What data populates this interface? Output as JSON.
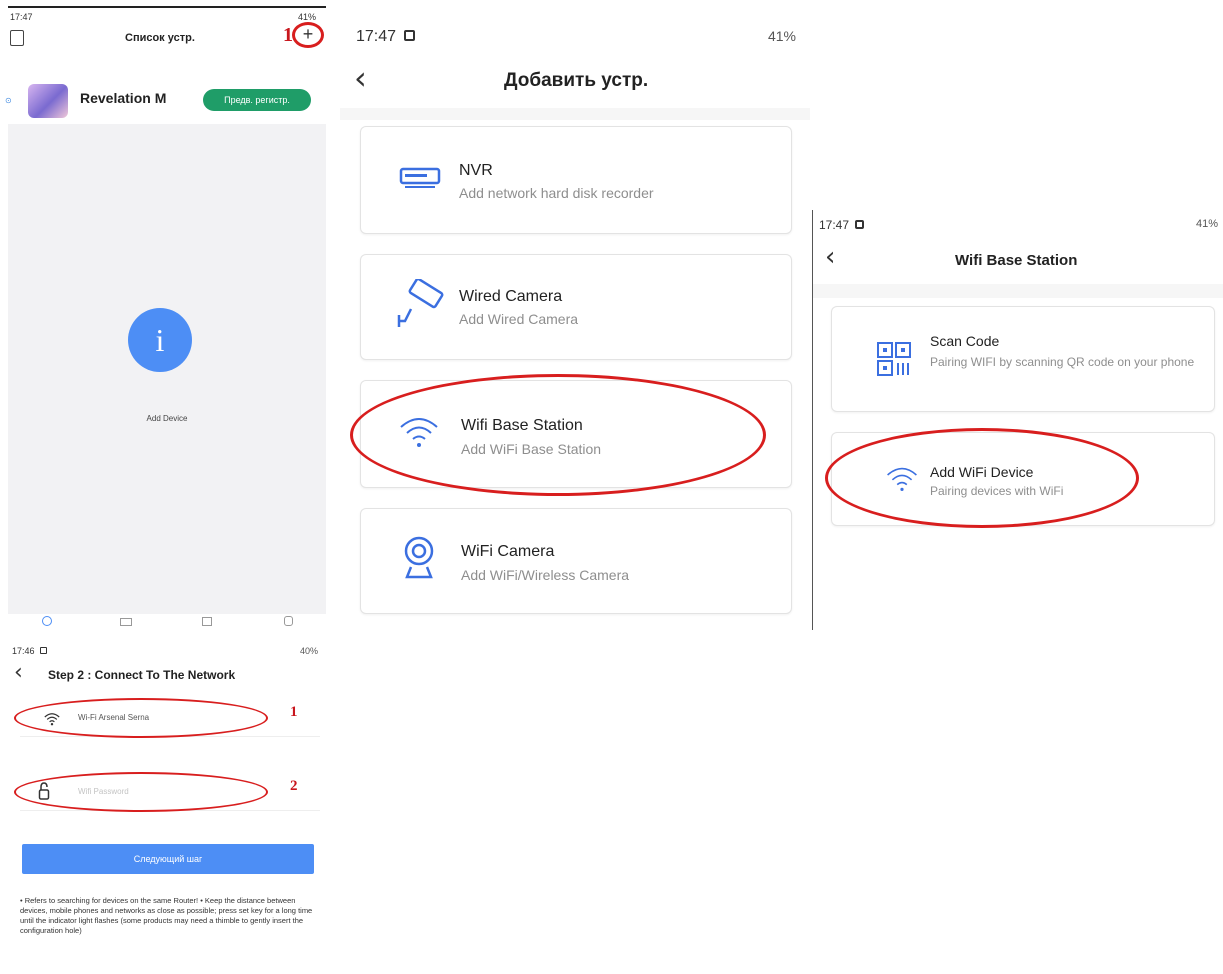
{
  "screen1": {
    "time": "17:47",
    "status_right": "41%",
    "title": "Список устр.",
    "marker": "1",
    "ad_title": "Revelation M",
    "ad_button": "Предв. регистр.",
    "add_device_label": "Add Device"
  },
  "screen2": {
    "time": "17:47",
    "status_right": "41%",
    "title": "Добавить устр.",
    "items": [
      {
        "title": "NVR",
        "subtitle": "Add network hard disk recorder"
      },
      {
        "title": "Wired Camera",
        "subtitle": "Add Wired Camera"
      },
      {
        "title": "Wifi Base Station",
        "subtitle": "Add WiFi Base Station"
      },
      {
        "title": "WiFi Camera",
        "subtitle": "Add WiFi/Wireless Camera"
      }
    ]
  },
  "screen3": {
    "time": "17:47",
    "status_right": "41%",
    "title": "Wifi Base Station",
    "items": [
      {
        "title": "Scan Code",
        "subtitle": "Pairing WIFI by scanning QR code on your phone"
      },
      {
        "title": "Add WiFi Device",
        "subtitle": "Pairing devices with WiFi"
      }
    ]
  },
  "screen4": {
    "time": "17:46",
    "status_right": "40%",
    "title": "Step 2 : Connect To The Network",
    "wifi_value": "Wi-Fi Arsenal Serna",
    "password_placeholder": "Wifi Password",
    "marker1": "1",
    "marker2": "2",
    "next_button": "Следующий шаг",
    "note": "• Refers to searching for devices on the same Router! • Keep the distance between devices, mobile phones and networks as close as possible; press set key for a long time until the indicator light flashes (some products may need a thimble to gently insert the configuration hole)"
  },
  "colors": {
    "accent": "#4d8ef5",
    "ad_button": "#1f9d68",
    "annotation": "#d81e1e",
    "icon_blue": "#3b6fe0"
  }
}
